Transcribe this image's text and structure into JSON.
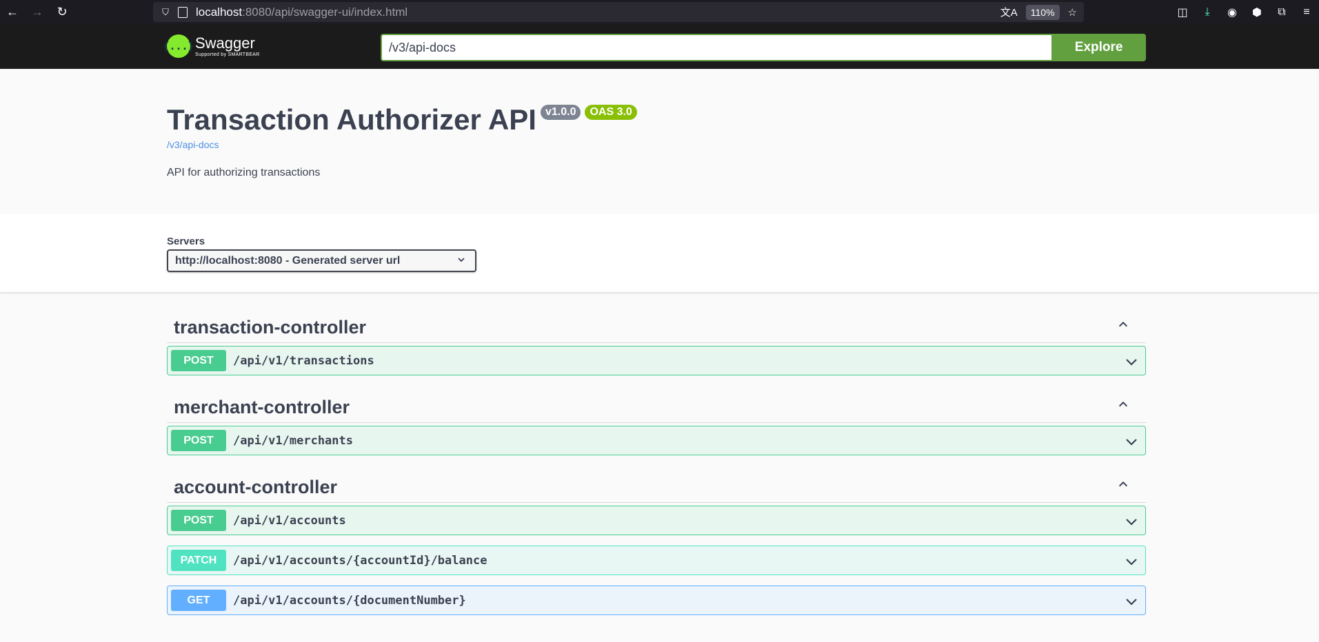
{
  "browser": {
    "url_host": "localhost",
    "url_rest": ":8080/api/swagger-ui/index.html",
    "zoom": "110%"
  },
  "topbar": {
    "logo_word": "Swagger",
    "logo_sub": "Supported by SMARTBEAR",
    "logo_glyph": "{...}",
    "explore_value": "/v3/api-docs",
    "explore_label": "Explore"
  },
  "info": {
    "title": "Transaction Authorizer API",
    "version": "v1.0.0",
    "oas": "OAS 3.0",
    "link": "/v3/api-docs",
    "description": "API for authorizing transactions"
  },
  "servers": {
    "label": "Servers",
    "selected": "http://localhost:8080 - Generated server url"
  },
  "tags": [
    {
      "name": "transaction-controller",
      "operations": [
        {
          "method": "POST",
          "path": "/api/v1/transactions"
        }
      ]
    },
    {
      "name": "merchant-controller",
      "operations": [
        {
          "method": "POST",
          "path": "/api/v1/merchants"
        }
      ]
    },
    {
      "name": "account-controller",
      "operations": [
        {
          "method": "POST",
          "path": "/api/v1/accounts"
        },
        {
          "method": "PATCH",
          "path": "/api/v1/accounts/{accountId}/balance"
        },
        {
          "method": "GET",
          "path": "/api/v1/accounts/{documentNumber}"
        }
      ]
    }
  ],
  "colors": {
    "post": "#49cc90",
    "patch": "#50e3c2",
    "get": "#61affe",
    "explore": "#62a03f",
    "version_badge": "#7d8492",
    "oas_badge": "#89bf04"
  },
  "icons": {
    "back": "arrow-left-icon",
    "forward": "arrow-right-icon",
    "reload": "reload-icon",
    "expand": "chevron-down-icon",
    "collapse": "chevron-up-icon"
  }
}
